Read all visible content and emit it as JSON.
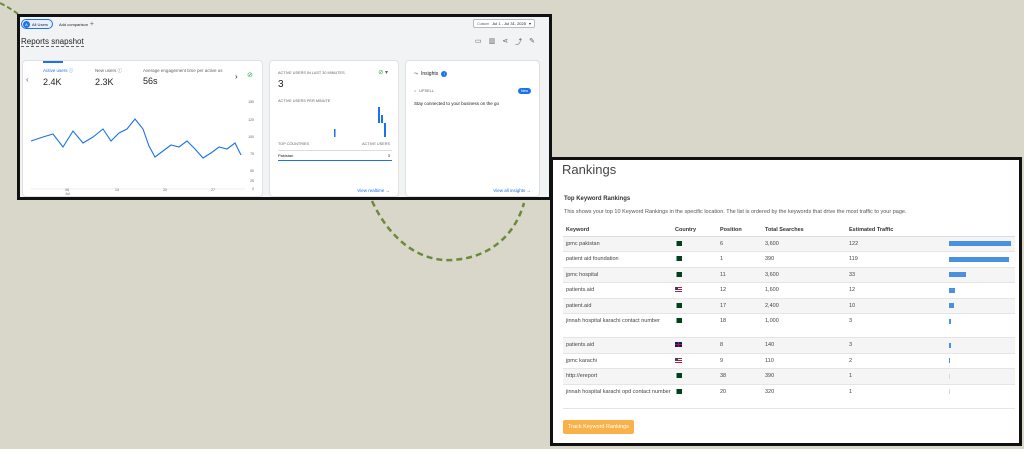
{
  "analytics": {
    "filter_chip": "All Users",
    "add_comparison": "Add comparison",
    "date_label": "Custom",
    "date_range": "Jul 1 - Jul 31, 2025",
    "snapshot_title": "Reports snapshot",
    "metrics": [
      {
        "label": "Active users",
        "value": "2.4K"
      },
      {
        "label": "New users",
        "value": "2.3K"
      },
      {
        "label": "Average engagement time per active us",
        "value": "56s"
      }
    ],
    "y_ticks": [
      "150",
      "120",
      "100",
      "75",
      "50",
      "25",
      "0"
    ],
    "x_ticks": [
      "06\nJul",
      "13",
      "20",
      "27"
    ],
    "realtime": {
      "header": "ACTIVE USERS IN LAST 30 MINUTES",
      "value": "3",
      "per_minute": "ACTIVE USERS PER MINUTE",
      "col_country": "TOP COUNTRIES",
      "col_users": "ACTIVE USERS",
      "row_country": "Pakistan",
      "row_users": "3",
      "link": "View realtime"
    },
    "insights": {
      "title": "Insights",
      "upsell": "UPSELL",
      "badge": "New",
      "text": "Stay connected to your business on the go",
      "link": "View all insights"
    }
  },
  "rankings": {
    "title": "Rankings",
    "subtitle": "Top Keyword Rankings",
    "description": "This shows your top 10 Keyword Rankings in the specific location. The list is ordered by the keywords that drive the most traffic to your page.",
    "columns": [
      "Keyword",
      "Country",
      "Position",
      "Total Searches",
      "Estimated Traffic"
    ],
    "rows": [
      {
        "keyword": "jpmc pakistan",
        "flag": "pk",
        "position": "6",
        "searches": "3,600",
        "traffic": "122",
        "share": 1.0
      },
      {
        "keyword": "patient aid foundation",
        "flag": "pk",
        "position": "1",
        "searches": "390",
        "traffic": "119",
        "share": 0.975
      },
      {
        "keyword": "jpmc hospital",
        "flag": "pk",
        "position": "11",
        "searches": "3,600",
        "traffic": "33",
        "share": 0.27
      },
      {
        "keyword": "patients.aid",
        "flag": "us",
        "position": "12",
        "searches": "1,600",
        "traffic": "12",
        "share": 0.1
      },
      {
        "keyword": "patient.aid",
        "flag": "pk",
        "position": "17",
        "searches": "2,400",
        "traffic": "10",
        "share": 0.085
      },
      {
        "keyword": "jinnah hospital karachi contact number",
        "flag": "pk",
        "position": "18",
        "searches": "1,000",
        "traffic": "3",
        "share": 0.03
      },
      {
        "keyword": "patients.aid",
        "flag": "gb",
        "position": "8",
        "searches": "140",
        "traffic": "3",
        "share": 0.03
      },
      {
        "keyword": "jpmc karachi",
        "flag": "us",
        "position": "9",
        "searches": "110",
        "traffic": "2",
        "share": 0.02
      },
      {
        "keyword": "http://ereport",
        "flag": "pk",
        "position": "38",
        "searches": "390",
        "traffic": "1",
        "share": 0.01
      },
      {
        "keyword": "jinnah hospital karachi opd contact number",
        "flag": "pk",
        "position": "20",
        "searches": "320",
        "traffic": "1",
        "share": 0.01
      }
    ],
    "button": "Track Keyword Rankings"
  },
  "colors": {
    "accent": "#1a73e8",
    "bar": "#4a90e2",
    "button": "#f9b24a"
  }
}
